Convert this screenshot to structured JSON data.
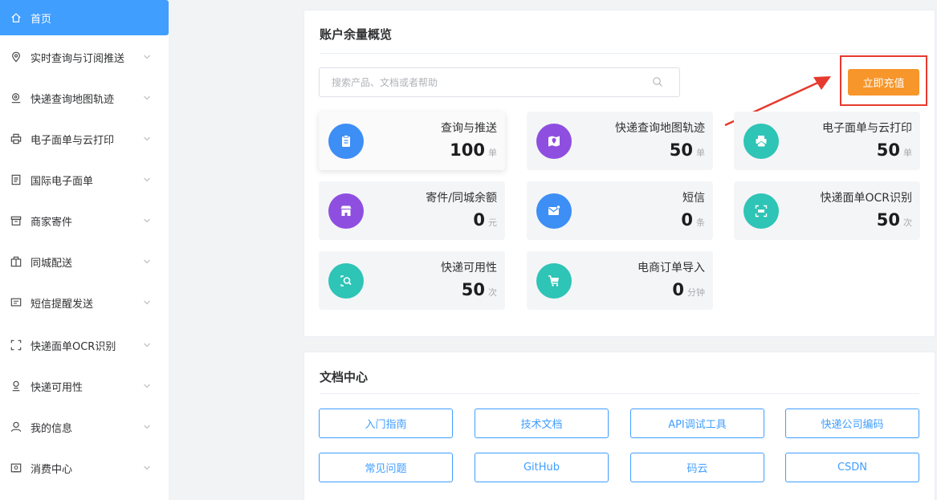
{
  "sidebar": {
    "items": [
      {
        "label": "首页",
        "icon": "home-icon"
      },
      {
        "label": "实时查询与订阅推送",
        "icon": "location-icon"
      },
      {
        "label": "快递查询地图轨迹",
        "icon": "map-search-icon"
      },
      {
        "label": "电子面单与云打印",
        "icon": "printer-icon"
      },
      {
        "label": "国际电子面单",
        "icon": "document-icon"
      },
      {
        "label": "商家寄件",
        "icon": "box-icon"
      },
      {
        "label": "同城配送",
        "icon": "package-icon"
      },
      {
        "label": "短信提醒发送",
        "icon": "message-icon"
      },
      {
        "label": "快递面单OCR识别",
        "icon": "scan-icon"
      },
      {
        "label": "快递可用性",
        "icon": "delivery-status-icon"
      },
      {
        "label": "我的信息",
        "icon": "user-icon"
      },
      {
        "label": "消费中心",
        "icon": "wallet-icon"
      }
    ]
  },
  "balance": {
    "title": "账户余量概览",
    "search_placeholder": "搜索产品、文档或者帮助",
    "recharge_label": "立即充值",
    "tiles": [
      {
        "name": "查询与推送",
        "value": "100",
        "unit": "单",
        "icon": "clipboard-icon",
        "color": "#3d8ef5"
      },
      {
        "name": "快递查询地图轨迹",
        "value": "50",
        "unit": "单",
        "icon": "map-icon",
        "color": "#8e4fe0"
      },
      {
        "name": "电子面单与云打印",
        "value": "50",
        "unit": "单",
        "icon": "cloud-print-icon",
        "color": "#2ec4b6"
      },
      {
        "name": "寄件/同城余额",
        "value": "0",
        "unit": "元",
        "icon": "store-icon",
        "color": "#8e4fe0"
      },
      {
        "name": "短信",
        "value": "0",
        "unit": "条",
        "icon": "envelope-icon",
        "color": "#3d8ef5"
      },
      {
        "name": "快递面单OCR识别",
        "value": "50",
        "unit": "次",
        "icon": "ocr-icon",
        "color": "#2ec4b6"
      },
      {
        "name": "快递可用性",
        "value": "50",
        "unit": "次",
        "icon": "search-doc-icon",
        "color": "#2ec4b6"
      },
      {
        "name": "电商订单导入",
        "value": "0",
        "unit": "分钟",
        "icon": "cart-icon",
        "color": "#2ec4b6"
      }
    ]
  },
  "docs": {
    "title": "文档中心",
    "links": [
      "入门指南",
      "技术文档",
      "API调试工具",
      "快递公司编码",
      "常见问题",
      "GitHub",
      "码云",
      "CSDN"
    ]
  },
  "colors": {
    "primary": "#409eff",
    "recharge": "#f7962b",
    "annotation_red": "#e63a2e"
  }
}
